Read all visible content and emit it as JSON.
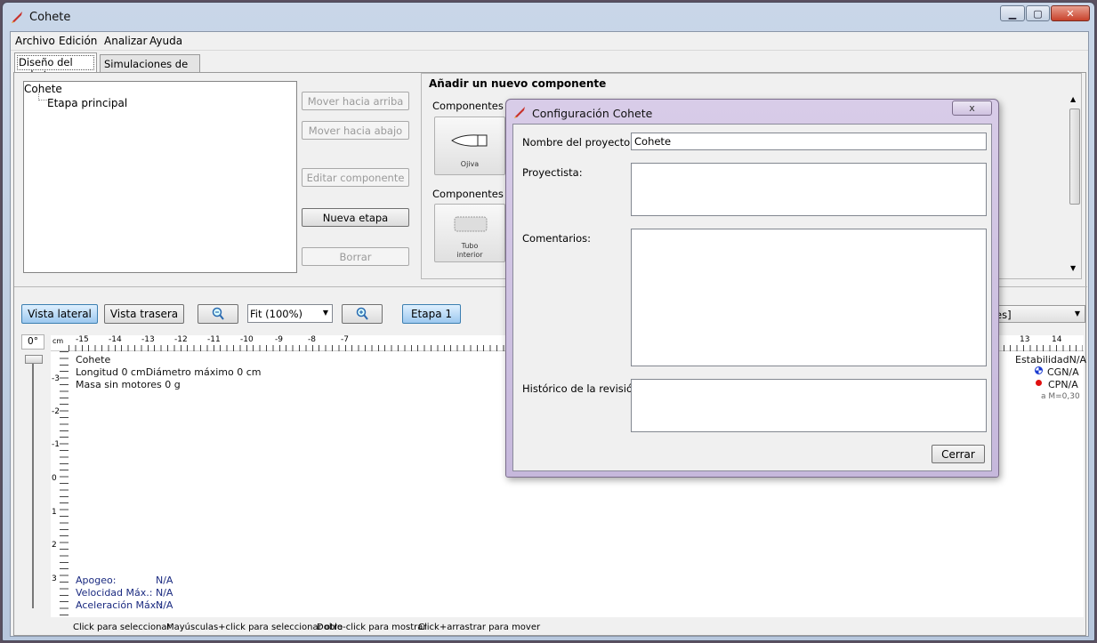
{
  "window": {
    "title": "Cohete"
  },
  "menu": {
    "items": [
      "Archivo",
      "Edición",
      "Analizar",
      "Ayuda"
    ]
  },
  "tabs": [
    {
      "label": "Diseño del cohete",
      "active": true
    },
    {
      "label": "Simulaciones de vuelo",
      "active": false
    }
  ],
  "tree": {
    "root": "Cohete",
    "child": "Etapa principal"
  },
  "side_buttons": {
    "move_up": "Mover hacia arriba",
    "move_down": "Mover hacia abajo",
    "edit": "Editar componente",
    "new_stage": "Nueva etapa",
    "delete": "Borrar"
  },
  "add_panel": {
    "title": "Añadir un nuevo componente",
    "section_body": "Componentes del",
    "section_inner": "Componentes inte",
    "nose_label": "Ojiva",
    "inner_tube_label": "Tubo\ninterior"
  },
  "toolbar": {
    "side_view": "Vista lateral",
    "back_view": "Vista trasera",
    "zoom": "Fit (100%)",
    "stage": "Etapa 1",
    "motors_partial": "tores]",
    "angle": "0°"
  },
  "ruler": {
    "unit": "cm",
    "left_ticks": [
      "-15",
      "-14",
      "-13",
      "-12",
      "-11",
      "-10",
      "-9",
      "-8",
      "-7"
    ],
    "right_ticks": [
      "13",
      "14"
    ],
    "v_ticks": [
      "-3",
      "-2",
      "-1",
      "0",
      "1",
      "2",
      "3"
    ]
  },
  "rocket_info": {
    "name": "Cohete",
    "length_line": "Longitud 0 cmDiámetro máximo 0 cm",
    "mass_line": "Masa sin motores 0 g"
  },
  "stability": {
    "label": "EstabilidadN/A",
    "cg": "CGN/A",
    "cp": "CPN/A",
    "mach": "a M=0,30",
    "colors": {
      "cg": "#1a3ad0",
      "cp": "#e01010"
    }
  },
  "flight": {
    "apogee_label": "Apogeo:",
    "apogee": "N/A",
    "velocity_label": "Velocidad Máx.:",
    "velocity": "N/A",
    "accel_label": "Aceleración Máx.:",
    "accel": "N/A"
  },
  "status_hints": [
    "Click para seleccionar",
    "Mayúsculas+click para seleccionar otro",
    "Doble-click para mostrar",
    "Click+arrastrar para mover"
  ],
  "dialog": {
    "title": "Configuración Cohete",
    "close_icon": "x",
    "project_name_label": "Nombre del proyecto:",
    "project_name_value": "Cohete",
    "designer_label": "Proyectista:",
    "designer_value": "",
    "comments_label": "Comentarios:",
    "comments_value": "",
    "revision_label": "Histórico de la revisión:",
    "revision_value": "",
    "close_button": "Cerrar"
  }
}
